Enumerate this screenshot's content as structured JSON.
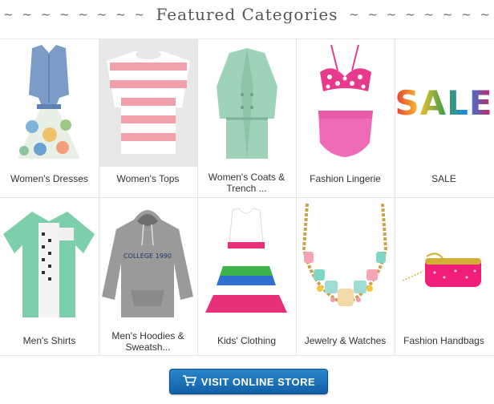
{
  "header": {
    "title": "Featured Categories",
    "left_decor": "~ ~ ~ ~ ~ ~ ~ ~ ~ ~ ~ ~ ~",
    "right_decor": "~ ~ ~ ~ ~ ~ ~ ~ ~ ~ ~ ~ ~"
  },
  "categories": [
    {
      "label": "Women's Dresses"
    },
    {
      "label": "Women's Tops"
    },
    {
      "label": "Women's Coats & Trench ..."
    },
    {
      "label": "Fashion Lingerie"
    },
    {
      "label": "SALE"
    },
    {
      "label": "Men's Shirts"
    },
    {
      "label": "Men's Hoodies & Sweatsh..."
    },
    {
      "label": "Kids' Clothing"
    },
    {
      "label": "Jewelry & Watches"
    },
    {
      "label": "Fashion Handbags"
    }
  ],
  "sale_image_text": "SALE",
  "hoodie_text": "COLLEGE 1990",
  "button": {
    "label": "VISIT ONLINE STORE",
    "icon": "cart-icon"
  }
}
